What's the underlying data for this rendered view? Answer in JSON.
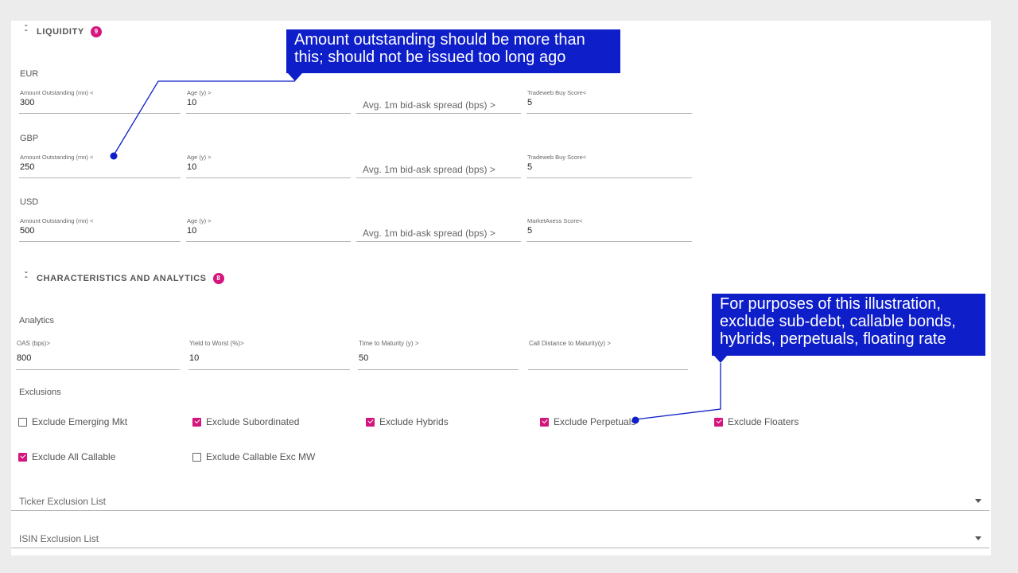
{
  "liquidity": {
    "title": "LIQUIDITY",
    "badge": "9",
    "rows": [
      {
        "currency": "EUR",
        "amount_label": "Amount Outstanding (mn) <",
        "amount_value": "300",
        "age_label": "Age (y) >",
        "age_value": "10",
        "spread_placeholder": "Avg. 1m bid-ask spread (bps) >",
        "score_label": "Tradeweb Buy Score<",
        "score_value": "5"
      },
      {
        "currency": "GBP",
        "amount_label": "Amount Outstanding (mn) <",
        "amount_value": "250",
        "age_label": "Age (y) >",
        "age_value": "10",
        "spread_placeholder": "Avg. 1m bid-ask spread (bps) >",
        "score_label": "Tradeweb Buy Score<",
        "score_value": "5"
      },
      {
        "currency": "USD",
        "amount_label": "Amount Outstanding (mn) <",
        "amount_value": "500",
        "age_label": "Age (y) >",
        "age_value": "10",
        "spread_placeholder": "Avg. 1m bid-ask spread (bps) >",
        "score_label": "MarketAxess Score<",
        "score_value": "5"
      }
    ]
  },
  "characteristics": {
    "title": "CHARACTERISTICS AND ANALYTICS",
    "badge": "8",
    "analytics_label": "Analytics",
    "fields": [
      {
        "label": "OAS (bps)>",
        "value": "800"
      },
      {
        "label": "Yield to Worst (%)>",
        "value": "10"
      },
      {
        "label": "Time to Maturity (y) >",
        "value": "50"
      },
      {
        "label": "Call Distance to Maturity(y) >",
        "value": ""
      }
    ],
    "exclusions_label": "Exclusions",
    "exclusions": [
      {
        "label": "Exclude Emerging Mkt",
        "checked": false
      },
      {
        "label": "Exclude Subordinated",
        "checked": true
      },
      {
        "label": "Exclude Hybrids",
        "checked": true
      },
      {
        "label": "Exclude Perpetuals",
        "checked": true
      },
      {
        "label": "Exclude Floaters",
        "checked": true
      },
      {
        "label": "Exclude All Callable",
        "checked": true
      },
      {
        "label": "Exclude Callable Exc MW",
        "checked": false
      }
    ],
    "ticker_exclusion_placeholder": "Ticker Exclusion List",
    "isin_exclusion_placeholder": "ISIN Exclusion List"
  },
  "callouts": {
    "top_line1": "Amount outstanding should be more than",
    "top_line2": "this; should not be issued too long ago",
    "right_line1": "For purposes of this illustration,",
    "right_line2": "exclude sub-debt, callable bonds,",
    "right_line3": "hybrids, perpetuals, floating rate"
  },
  "colors": {
    "accent": "#d4157d",
    "callout": "#0e1ec9",
    "panel": "#ffffff",
    "background": "#ececec"
  }
}
